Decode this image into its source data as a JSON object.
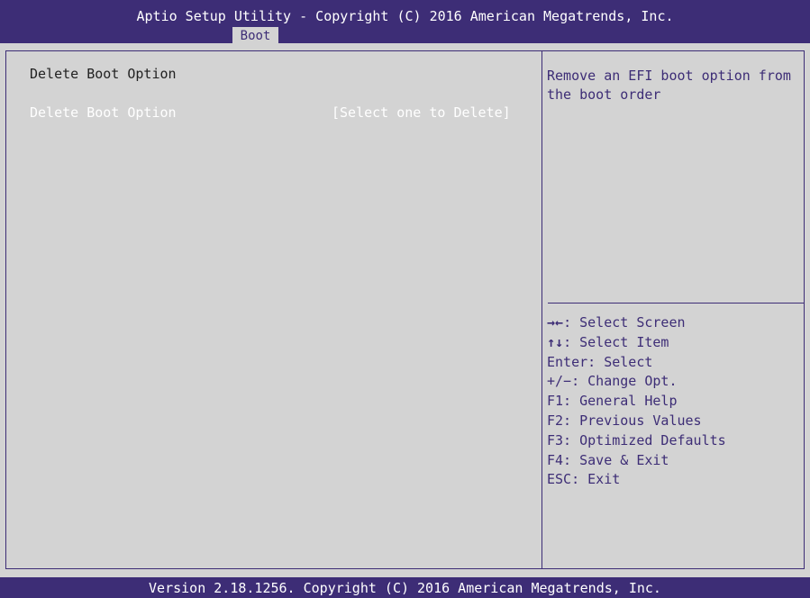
{
  "header": {
    "title": "Aptio Setup Utility - Copyright (C) 2016 American Megatrends, Inc.",
    "active_tab": "Boot"
  },
  "main": {
    "section_title": "Delete Boot Option",
    "option": {
      "label": "Delete Boot Option",
      "value": "[Select one to Delete]"
    }
  },
  "help": {
    "lines": [
      "Remove an EFI boot option from",
      "the boot order"
    ]
  },
  "keys": {
    "select_screen": {
      "glyph": "→←",
      "text": ": Select Screen"
    },
    "select_item": {
      "glyph": "↑↓",
      "text": ": Select Item"
    },
    "enter": "Enter: Select",
    "change": "+/−: Change Opt.",
    "f1": "F1: General Help",
    "f2": "F2: Previous Values",
    "f3": "F3: Optimized Defaults",
    "f4": "F4: Save & Exit",
    "esc": "ESC: Exit"
  },
  "footer": {
    "text": "Version 2.18.1256. Copyright (C) 2016 American Megatrends, Inc."
  },
  "colors": {
    "bar": "#3d2d76",
    "background": "#d3d3d3",
    "highlight_text": "#ffffff"
  }
}
